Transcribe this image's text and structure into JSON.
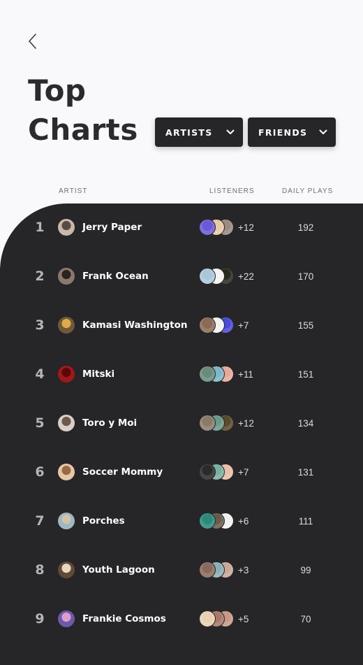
{
  "icons": {
    "back": "chevron-left-icon",
    "dropdown": "chevron-down-icon"
  },
  "colors": {
    "background": "#f9f9fb",
    "panel": "#262628",
    "title": "#2b2b2c",
    "dropdown": "#262628"
  },
  "header": {
    "title_line1": "Top",
    "title_line2": "Charts"
  },
  "filters": {
    "artists_label": "ARTISTS",
    "friends_label": "FRIENDS"
  },
  "columns": {
    "artist": "ARTIST",
    "listeners": "LISTENERS",
    "daily_plays": "DAILY PLAYS"
  },
  "rows": [
    {
      "rank": "1",
      "artist": "Jerry Paper",
      "listeners_more": "+12",
      "daily_plays": "192"
    },
    {
      "rank": "2",
      "artist": "Frank Ocean",
      "listeners_more": "+22",
      "daily_plays": "170"
    },
    {
      "rank": "3",
      "artist": "Kamasi Washington",
      "listeners_more": "+7",
      "daily_plays": "155"
    },
    {
      "rank": "4",
      "artist": "Mitski",
      "listeners_more": "+11",
      "daily_plays": "151"
    },
    {
      "rank": "5",
      "artist": "Toro y Moi",
      "listeners_more": "+12",
      "daily_plays": "134"
    },
    {
      "rank": "6",
      "artist": "Soccer Mommy",
      "listeners_more": "+7",
      "daily_plays": "131"
    },
    {
      "rank": "7",
      "artist": "Porches",
      "listeners_more": "+6",
      "daily_plays": "111"
    },
    {
      "rank": "8",
      "artist": "Youth Lagoon",
      "listeners_more": "+3",
      "daily_plays": "99"
    },
    {
      "rank": "9",
      "artist": "Frankie Cosmos",
      "listeners_more": "+5",
      "daily_plays": "70"
    }
  ]
}
